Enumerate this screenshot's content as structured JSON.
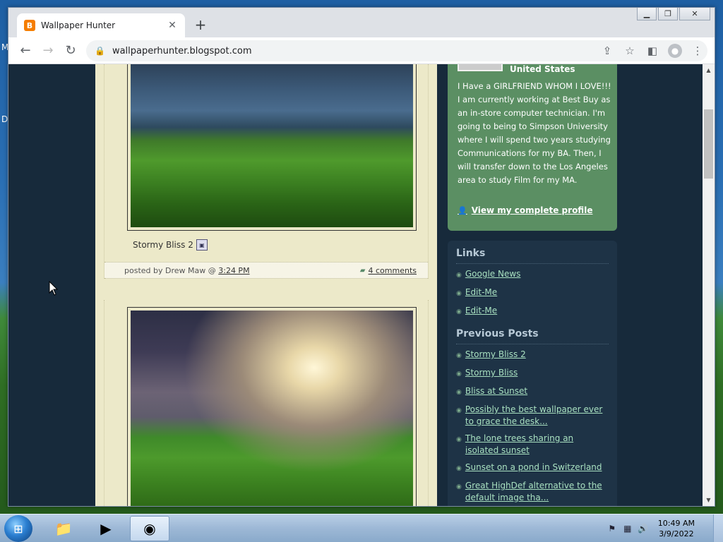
{
  "desktop": {
    "letters": [
      "M",
      "D"
    ]
  },
  "browser": {
    "tab_title": "Wallpaper Hunter",
    "tab_favicon": "B",
    "new_tab": "+",
    "url": "wallpaperhunter.blogspot.com",
    "window_controls": [
      "minimize-icon",
      "restore-icon",
      "close-icon"
    ]
  },
  "posts": [
    {
      "caption": "Stormy Bliss 2",
      "posted_by": "posted by Drew Maw @",
      "time": "3:24 PM",
      "comments": "4 comments"
    }
  ],
  "profile": {
    "country": "United States",
    "bio": "I Have a GIRLFRIEND WHOM I LOVE!!! I am currently working at Best Buy as an in-store computer technician. I'm going to being to Simpson University where I will spend two years studying Communications for my BA. Then, I will transfer down to the Los Angeles area to study Film for my MA.",
    "link": "View my complete profile"
  },
  "sidebar": {
    "links_heading": "Links",
    "links": [
      "Google News",
      "Edit-Me",
      "Edit-Me"
    ],
    "previous_heading": "Previous Posts",
    "previous": [
      "Stormy Bliss 2",
      "Stormy Bliss",
      "Bliss at Sunset",
      "Possibly the best wallpaper ever to grace the desk...",
      "The lone trees sharing an isolated sunset",
      "Sunset on a pond in Switzerland",
      "Great HighDef alternative to the default image tha..."
    ]
  },
  "taskbar": {
    "time": "10:49 AM",
    "date": "3/9/2022"
  }
}
